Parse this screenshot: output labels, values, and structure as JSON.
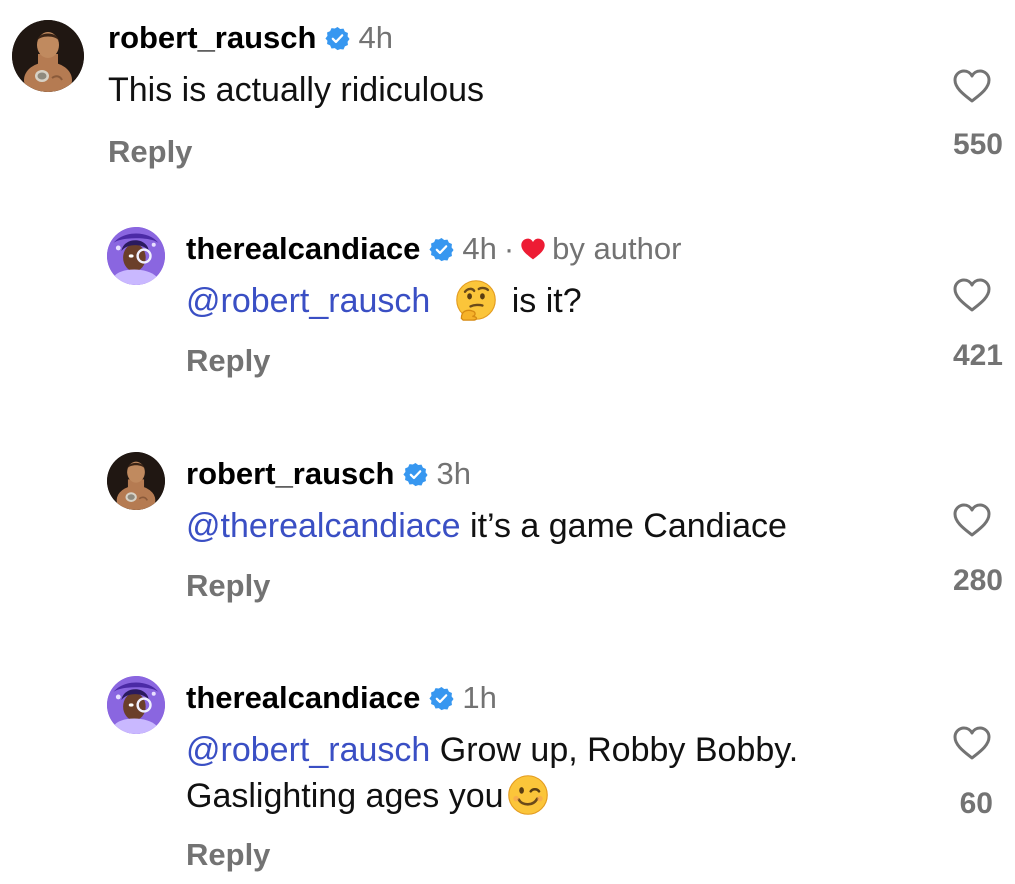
{
  "comments": [
    {
      "username": "robert_rausch",
      "time": "4h",
      "text": "This is actually ridiculous",
      "reply_label": "Reply",
      "like_count": "550",
      "avatar_icon": "robert-rausch-avatar",
      "verified": true
    },
    {
      "username": "therealcandiace",
      "time": "4h",
      "separator": "·",
      "badge_label": "by author",
      "mention": "@robert_rausch",
      "text_after": "is it?",
      "emoji_icon": "thinking-face-emoji",
      "reply_label": "Reply",
      "like_count": "421",
      "avatar_icon": "therealcandiace-avatar",
      "verified": true
    },
    {
      "username": "robert_rausch",
      "time": "3h",
      "mention": "@therealcandiace",
      "text_after": " it’s a game Candiace",
      "reply_label": "Reply",
      "like_count": "280",
      "avatar_icon": "robert-rausch-avatar",
      "verified": true
    },
    {
      "username": "therealcandiace",
      "time": "1h",
      "mention": "@robert_rausch",
      "text_line1": " Grow up, Robby Bobby.",
      "text_line2": "Gaslighting ages you",
      "emoji_icon": "winking-face-emoji",
      "reply_label": "Reply",
      "like_count": "60",
      "avatar_icon": "therealcandiace-avatar",
      "verified": true
    }
  ],
  "colors": {
    "secondary_text": "#737373",
    "mention": "#3a4fc4",
    "verified_blue": "#3797f0",
    "author_heart": "#ed1c34"
  }
}
